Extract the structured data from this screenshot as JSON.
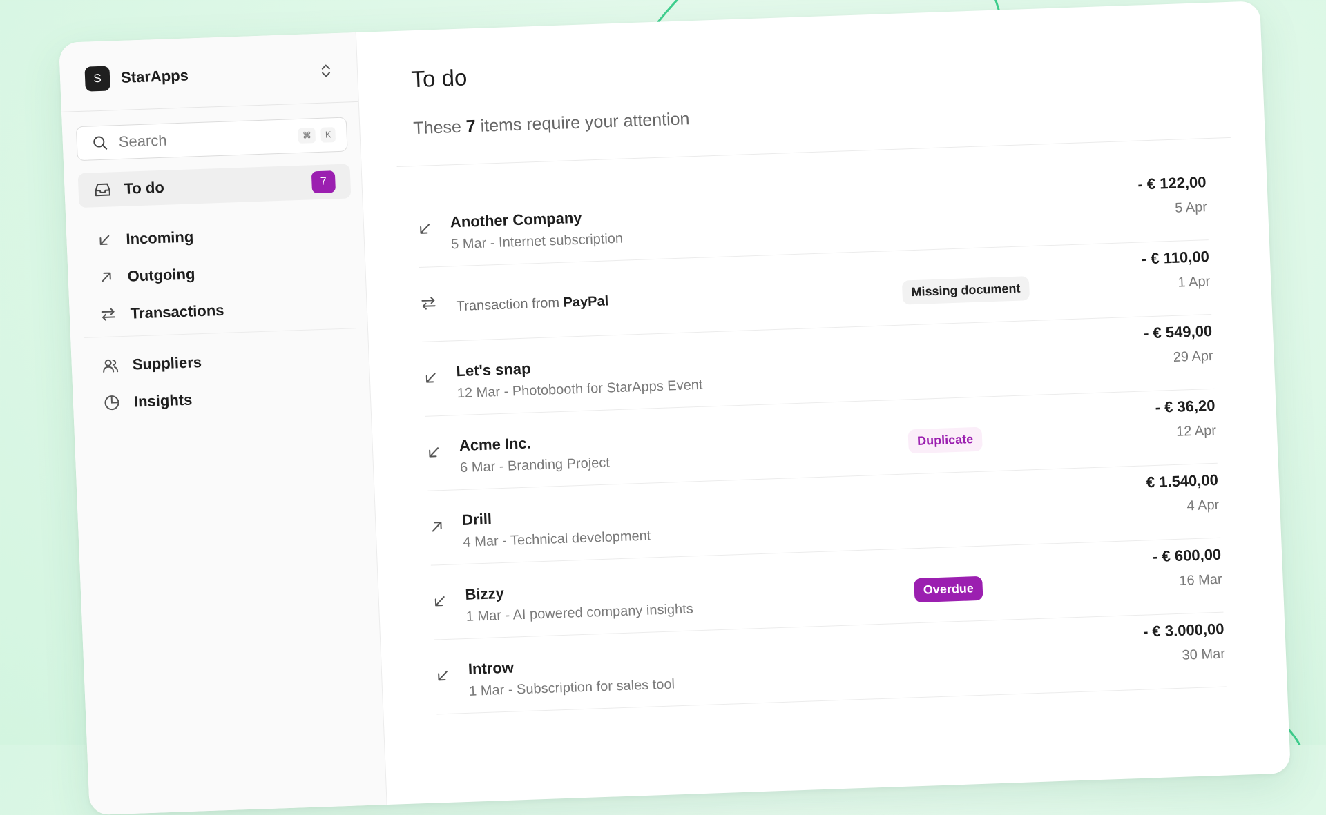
{
  "workspace": {
    "initial": "S",
    "name": "StarApps"
  },
  "search": {
    "placeholder": "Search",
    "shortcut_cmd": "⌘",
    "shortcut_key": "K"
  },
  "nav": {
    "todo": {
      "label": "To do",
      "count": "7"
    },
    "items": [
      {
        "label": "Incoming",
        "icon": "arrow-down-left-icon"
      },
      {
        "label": "Outgoing",
        "icon": "arrow-up-right-icon"
      },
      {
        "label": "Transactions",
        "icon": "arrows-swap-icon"
      },
      {
        "label": "Suppliers",
        "icon": "users-icon"
      },
      {
        "label": "Insights",
        "icon": "pie-chart-icon"
      }
    ]
  },
  "main": {
    "title": "To do",
    "subtitle_pre": "These",
    "subtitle_count": "7",
    "subtitle_post": "items require your attention",
    "items": [
      {
        "name": "Another Company",
        "sub": "5 Mar - Internet subscription",
        "amount": "- € 122,00",
        "date": "5 Apr",
        "icon": "arrow-down-left-icon"
      },
      {
        "tx_pre": "Transaction from",
        "tx_name": "PayPal",
        "tag": "Missing document",
        "amount": "- € 110,00",
        "date": "1 Apr",
        "icon": "arrows-swap-icon"
      },
      {
        "name": "Let's snap",
        "sub": "12 Mar - Photobooth for StarApps Event",
        "amount": "- € 549,00",
        "date": "29 Apr",
        "icon": "arrow-down-left-icon"
      },
      {
        "name": "Acme Inc.",
        "sub": "6 Mar - Branding Project",
        "tag": "Duplicate",
        "amount": "- € 36,20",
        "date": "12 Apr",
        "icon": "arrow-down-left-icon"
      },
      {
        "name": "Drill",
        "sub": "4 Mar - Technical development",
        "amount": "€ 1.540,00",
        "date": "4 Apr",
        "icon": "arrow-up-right-icon"
      },
      {
        "name": "Bizzy",
        "sub": "1 Mar - AI powered company insights",
        "tag": "Overdue",
        "amount": "- € 600,00",
        "date": "16 Mar",
        "icon": "arrow-down-left-icon"
      },
      {
        "name": "Introw",
        "sub": "1 Mar - Subscription for sales tool",
        "amount": "- € 3.000,00",
        "date": "30 Mar",
        "icon": "arrow-down-left-icon"
      }
    ]
  },
  "colors": {
    "accent": "#9b1fb0",
    "background": "#dff8e8",
    "deco_line": "#3fcf8e"
  }
}
